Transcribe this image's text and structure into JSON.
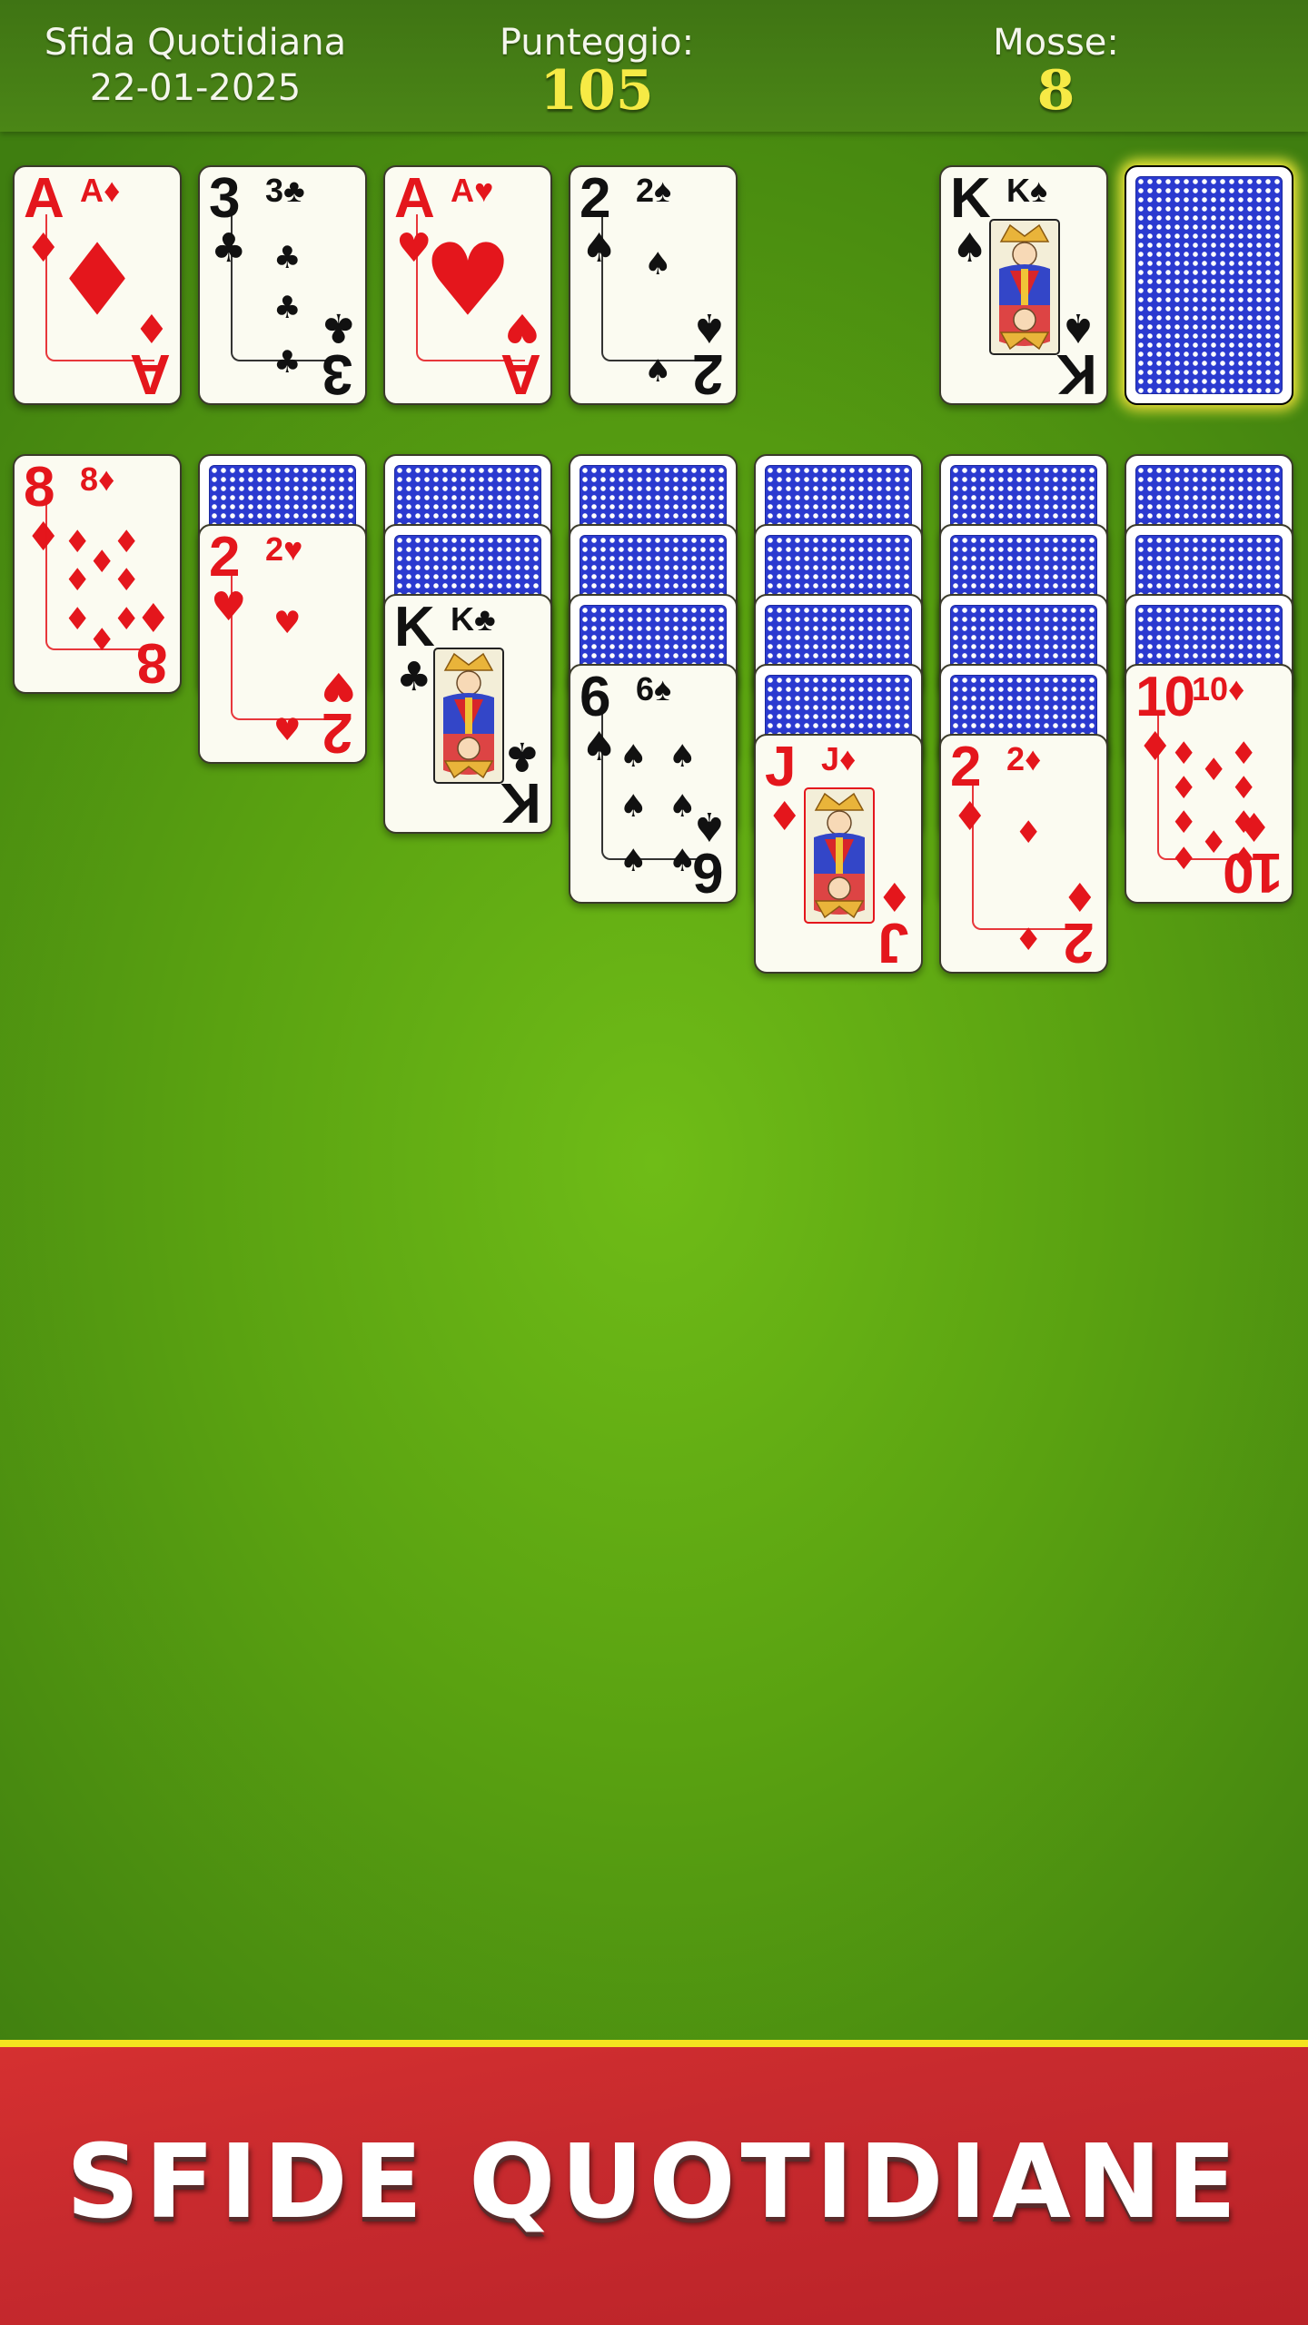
{
  "header": {
    "mode_label": "Sfida Quotidiana",
    "date": "22-01-2025",
    "score_label": "Punteggio:",
    "score": "105",
    "moves_label": "Mosse:",
    "moves": "8"
  },
  "colors": {
    "table": "#5aa211",
    "card_back": "#2b3ad0",
    "red_suit": "#e4161c",
    "banner": "#c72a2e",
    "highlight": "#f0ea3a",
    "score": "#f6ea45"
  },
  "foundations": [
    {
      "rank": "A",
      "suit": "♦",
      "color": "red"
    },
    {
      "rank": "3",
      "suit": "♣",
      "color": "blk"
    },
    {
      "rank": "A",
      "suit": "♥",
      "color": "red"
    },
    {
      "rank": "2",
      "suit": "♠",
      "color": "blk"
    }
  ],
  "waste": {
    "rank": "K",
    "suit": "♠",
    "color": "blk"
  },
  "stock": {
    "face_down": true
  },
  "tableau": [
    {
      "hidden": 0,
      "card": {
        "rank": "8",
        "suit": "♦",
        "color": "red"
      }
    },
    {
      "hidden": 1,
      "card": {
        "rank": "2",
        "suit": "♥",
        "color": "red"
      }
    },
    {
      "hidden": 2,
      "card": {
        "rank": "K",
        "suit": "♣",
        "color": "blk"
      }
    },
    {
      "hidden": 3,
      "card": {
        "rank": "6",
        "suit": "♠",
        "color": "blk"
      }
    },
    {
      "hidden": 4,
      "card": {
        "rank": "J",
        "suit": "♦",
        "color": "red"
      }
    },
    {
      "hidden": 4,
      "card": {
        "rank": "2",
        "suit": "♦",
        "color": "red"
      }
    },
    {
      "hidden": 3,
      "card": {
        "rank": "10",
        "suit": "♦",
        "color": "red"
      }
    }
  ],
  "banner": {
    "title": "SFIDE QUOTIDIANE"
  }
}
